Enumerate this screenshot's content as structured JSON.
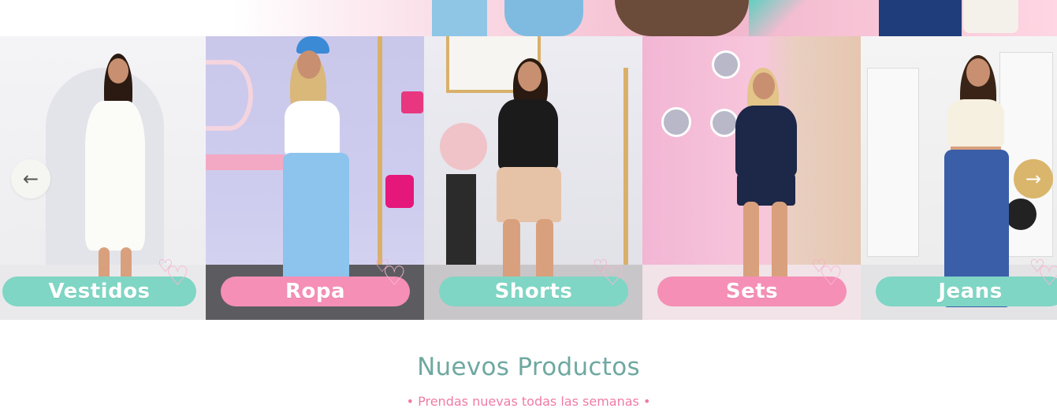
{
  "carousel": {
    "prev_icon": "←",
    "next_icon": "→",
    "slides": [
      {
        "label": "Vestidos",
        "pill_color": "#7fd6c4"
      },
      {
        "label": "Ropa",
        "pill_color": "#f58fb6"
      },
      {
        "label": "Shorts",
        "pill_color": "#7fd6c4"
      },
      {
        "label": "Sets",
        "pill_color": "#f58fb6"
      },
      {
        "label": "Jeans",
        "pill_color": "#7fd6c4"
      }
    ]
  },
  "section": {
    "title": "Nuevos Productos",
    "subtitle": "• Prendas nuevas todas las semanas •"
  },
  "colors": {
    "title": "#6fa8a1",
    "subtitle": "#f07ba6",
    "next_arrow": "#d9b66b"
  },
  "icons": [
    "arrow-left-icon",
    "arrow-right-icon",
    "hearts-icon"
  ]
}
